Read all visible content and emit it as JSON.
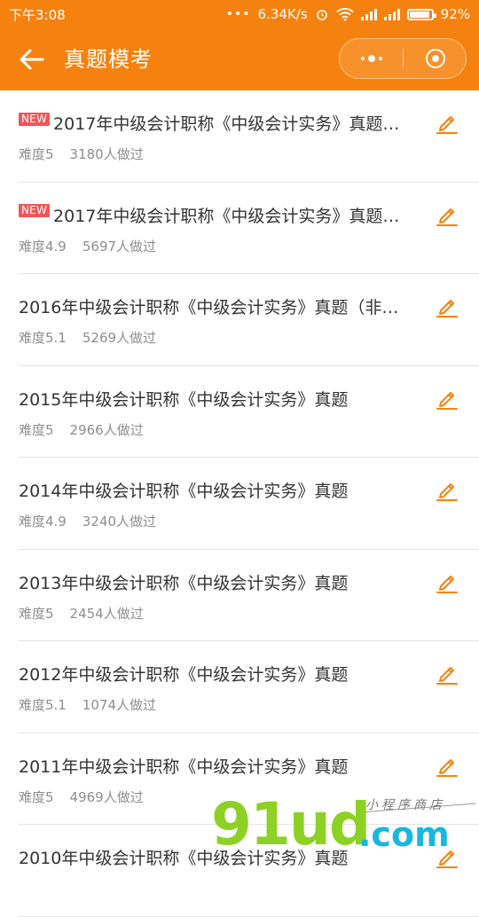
{
  "status_bar": {
    "time": "下午3:08",
    "dots": "•••",
    "speed": "6.34K/s",
    "battery_pct": "92%",
    "battery_level": 0.92
  },
  "nav": {
    "title": "真题模考",
    "back_icon": "arrow-left-icon",
    "more_icon": "more-dots-icon",
    "close_icon": "target-circle-icon"
  },
  "colors": {
    "header": "#f5820f",
    "accent": "#f5820f",
    "badge": "#f25557"
  },
  "exams": [
    {
      "new": "NEW",
      "title": "2017年中级会计职称《中级会计实务》真题…",
      "difficulty": "难度5",
      "count": "3180人做过"
    },
    {
      "new": "NEW",
      "title": "2017年中级会计职称《中级会计实务》真题…",
      "difficulty": "难度4.9",
      "count": "5697人做过"
    },
    {
      "new": "",
      "title": "2016年中级会计职称《中级会计实务》真题（非…",
      "difficulty": "难度5.1",
      "count": "5269人做过"
    },
    {
      "new": "",
      "title": "2015年中级会计职称《中级会计实务》真题",
      "difficulty": "难度5",
      "count": "2966人做过"
    },
    {
      "new": "",
      "title": "2014年中级会计职称《中级会计实务》真题",
      "difficulty": "难度4.9",
      "count": "3240人做过"
    },
    {
      "new": "",
      "title": "2013年中级会计职称《中级会计实务》真题",
      "difficulty": "难度5",
      "count": "2454人做过"
    },
    {
      "new": "",
      "title": "2012年中级会计职称《中级会计实务》真题",
      "difficulty": "难度5.1",
      "count": "1074人做过"
    },
    {
      "new": "",
      "title": "2011年中级会计职称《中级会计实务》真题",
      "difficulty": "难度5",
      "count": "4969人做过"
    },
    {
      "new": "",
      "title": "2010年中级会计职称《中级会计实务》真题",
      "difficulty": "",
      "count": ""
    }
  ],
  "watermark": {
    "brand": "91ud",
    "domain": ".com",
    "tagline": "小程序商店"
  }
}
